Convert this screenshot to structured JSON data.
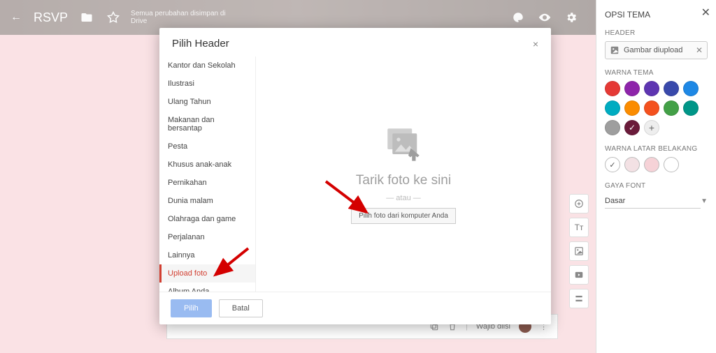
{
  "appbar": {
    "back_icon": "←",
    "title": "RSVP",
    "folder_icon": "folder",
    "star_icon": "star",
    "subtitle": "Semua perubahan disimpan di Drive",
    "right_icons": [
      "palette",
      "eye",
      "gear"
    ]
  },
  "dialog": {
    "title": "Pilih Header",
    "close": "×",
    "categories": [
      "Kantor dan Sekolah",
      "Ilustrasi",
      "Ulang Tahun",
      "Makanan dan bersantap",
      "Pesta",
      "Khusus anak-anak",
      "Pernikahan",
      "Dunia malam",
      "Olahraga dan game",
      "Perjalanan",
      "Lainnya",
      "Upload foto",
      "Album Anda"
    ],
    "selected_index": 11,
    "drop_text": "Tarik foto ke sini",
    "or_text": "— atau —",
    "pick_button": "Pilih foto dari komputer Anda",
    "footer": {
      "primary": "Pilih",
      "secondary": "Batal"
    }
  },
  "panel": {
    "title": "OPSI TEMA",
    "header_label": "HEADER",
    "header_chip": "Gambar diupload",
    "theme_color_label": "WARNA TEMA",
    "theme_colors": [
      "#e53935",
      "#8e24aa",
      "#5e35b1",
      "#3949ab",
      "#1e88e5",
      "#00acc1",
      "#fb8c00",
      "#f4511e",
      "#43a047",
      "#009688",
      "#9e9e9e"
    ],
    "selected_color": "#6a1b3a",
    "bg_label": "WARNA LATAR BELAKANG",
    "bg_colors": [
      "#ffffff",
      "#f3e1e4",
      "#f6d2d7",
      "#ffffff"
    ],
    "bg_selected_index": 0,
    "font_label": "GAYA FONT",
    "font_value": "Dasar"
  },
  "form_strip": {
    "required_label": "Wajib diisi"
  }
}
